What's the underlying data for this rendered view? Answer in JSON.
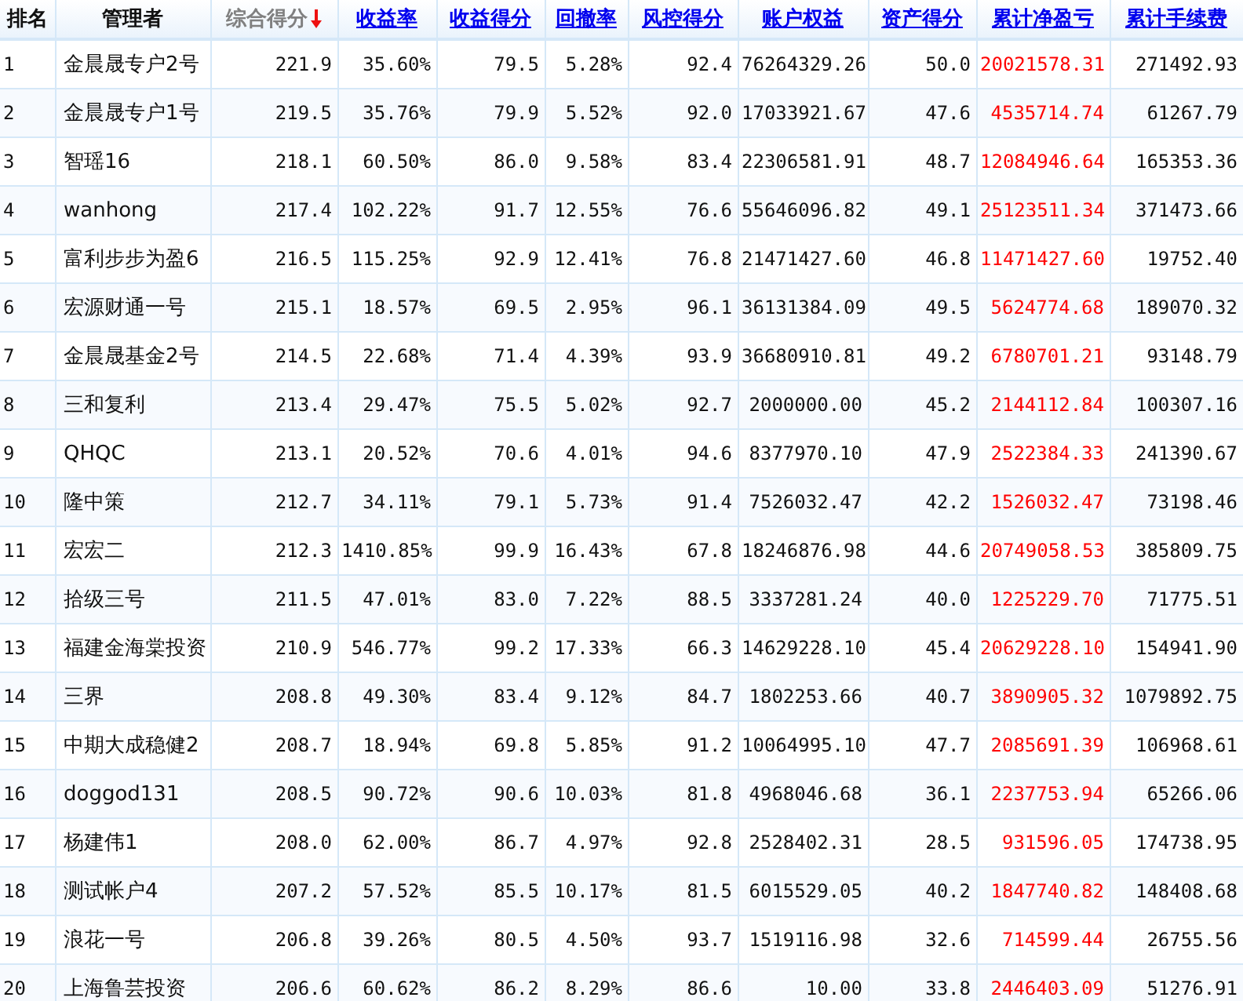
{
  "table": {
    "columns": [
      {
        "label": "排名",
        "kind": "plain"
      },
      {
        "label": "管理者",
        "kind": "plain"
      },
      {
        "label": "综合得分",
        "kind": "sorted"
      },
      {
        "label": "收益率",
        "kind": "link"
      },
      {
        "label": "收益得分",
        "kind": "link"
      },
      {
        "label": "回撤率",
        "kind": "link"
      },
      {
        "label": "风控得分",
        "kind": "link"
      },
      {
        "label": "账户权益",
        "kind": "link"
      },
      {
        "label": "资产得分",
        "kind": "link"
      },
      {
        "label": "累计净盈亏",
        "kind": "link",
        "color": "#ff0000"
      },
      {
        "label": "累计手续费",
        "kind": "link"
      }
    ],
    "rows": [
      [
        "1",
        "金晨晟专户2号",
        "221.9",
        "35.60%",
        "79.5",
        "5.28%",
        "92.4",
        "76264329.26",
        "50.0",
        "20021578.31",
        "271492.93"
      ],
      [
        "2",
        "金晨晟专户1号",
        "219.5",
        "35.76%",
        "79.9",
        "5.52%",
        "92.0",
        "17033921.67",
        "47.6",
        "4535714.74",
        "61267.79"
      ],
      [
        "3",
        "智瑶16",
        "218.1",
        "60.50%",
        "86.0",
        "9.58%",
        "83.4",
        "22306581.91",
        "48.7",
        "12084946.64",
        "165353.36"
      ],
      [
        "4",
        "wanhong",
        "217.4",
        "102.22%",
        "91.7",
        "12.55%",
        "76.6",
        "55646096.82",
        "49.1",
        "25123511.34",
        "371473.66"
      ],
      [
        "5",
        "富利步步为盈6",
        "216.5",
        "115.25%",
        "92.9",
        "12.41%",
        "76.8",
        "21471427.60",
        "46.8",
        "11471427.60",
        "19752.40"
      ],
      [
        "6",
        "宏源财通一号",
        "215.1",
        "18.57%",
        "69.5",
        "2.95%",
        "96.1",
        "36131384.09",
        "49.5",
        "5624774.68",
        "189070.32"
      ],
      [
        "7",
        "金晨晟基金2号",
        "214.5",
        "22.68%",
        "71.4",
        "4.39%",
        "93.9",
        "36680910.81",
        "49.2",
        "6780701.21",
        "93148.79"
      ],
      [
        "8",
        "三和复利",
        "213.4",
        "29.47%",
        "75.5",
        "5.02%",
        "92.7",
        "2000000.00",
        "45.2",
        "2144112.84",
        "100307.16"
      ],
      [
        "9",
        "QHQC",
        "213.1",
        "20.52%",
        "70.6",
        "4.01%",
        "94.6",
        "8377970.10",
        "47.9",
        "2522384.33",
        "241390.67"
      ],
      [
        "10",
        "隆中策",
        "212.7",
        "34.11%",
        "79.1",
        "5.73%",
        "91.4",
        "7526032.47",
        "42.2",
        "1526032.47",
        "73198.46"
      ],
      [
        "11",
        "宏宏二",
        "212.3",
        "1410.85%",
        "99.9",
        "16.43%",
        "67.8",
        "18246876.98",
        "44.6",
        "20749058.53",
        "385809.75"
      ],
      [
        "12",
        "拾级三号",
        "211.5",
        "47.01%",
        "83.0",
        "7.22%",
        "88.5",
        "3337281.24",
        "40.0",
        "1225229.70",
        "71775.51"
      ],
      [
        "13",
        "福建金海棠投资",
        "210.9",
        "546.77%",
        "99.2",
        "17.33%",
        "66.3",
        "14629228.10",
        "45.4",
        "20629228.10",
        "154941.90"
      ],
      [
        "14",
        "三界",
        "208.8",
        "49.30%",
        "83.4",
        "9.12%",
        "84.7",
        "1802253.66",
        "40.7",
        "3890905.32",
        "1079892.75"
      ],
      [
        "15",
        "中期大成稳健2",
        "208.7",
        "18.94%",
        "69.8",
        "5.85%",
        "91.2",
        "10064995.10",
        "47.7",
        "2085691.39",
        "106968.61"
      ],
      [
        "16",
        "doggod131",
        "208.5",
        "90.72%",
        "90.6",
        "10.03%",
        "81.8",
        "4968046.68",
        "36.1",
        "2237753.94",
        "65266.06"
      ],
      [
        "17",
        "杨建伟1",
        "208.0",
        "62.00%",
        "86.7",
        "4.97%",
        "92.8",
        "2528402.31",
        "28.5",
        "931596.05",
        "174738.95"
      ],
      [
        "18",
        "测试帐户4",
        "207.2",
        "57.52%",
        "85.5",
        "10.17%",
        "81.5",
        "6015529.05",
        "40.2",
        "1847740.82",
        "148408.68"
      ],
      [
        "19",
        "浪花一号",
        "206.8",
        "39.26%",
        "80.5",
        "4.50%",
        "93.7",
        "1519116.98",
        "32.6",
        "714599.44",
        "26755.56"
      ],
      [
        "20",
        "上海鲁芸投资",
        "206.6",
        "60.62%",
        "86.2",
        "8.29%",
        "86.6",
        "10.00",
        "33.8",
        "2446403.09",
        "51276.91"
      ]
    ]
  }
}
